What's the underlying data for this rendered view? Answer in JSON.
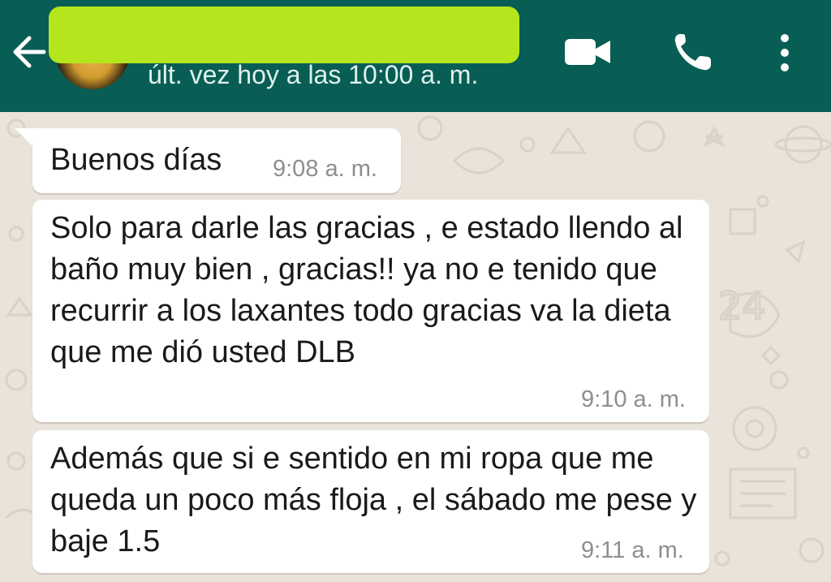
{
  "header": {
    "last_seen": "últ. vez hoy a las 10:00 a. m.",
    "icons": [
      "back-arrow-icon",
      "video-call-icon",
      "phone-call-icon",
      "more-vert-icon"
    ]
  },
  "colors": {
    "header_bg": "#085e54",
    "name_redaction": "#b5e61d",
    "chat_bg": "#e9e3da",
    "bubble_bg": "#ffffff",
    "timestamp": "#8e8e8e"
  },
  "messages": [
    {
      "text": "Buenos días",
      "time": "9:08 a. m."
    },
    {
      "text": "Solo para darle las gracias , e estado llendo al baño muy bien , gracias!! ya no e tenido que recurrir a los laxantes todo gracias va la dieta que me dió usted DLB",
      "time": "9:10 a. m."
    },
    {
      "text": "Además que si e sentido en mi ropa que me queda un poco más floja , el sábado me pese y baje 1.5",
      "time": "9:11 a. m."
    }
  ]
}
